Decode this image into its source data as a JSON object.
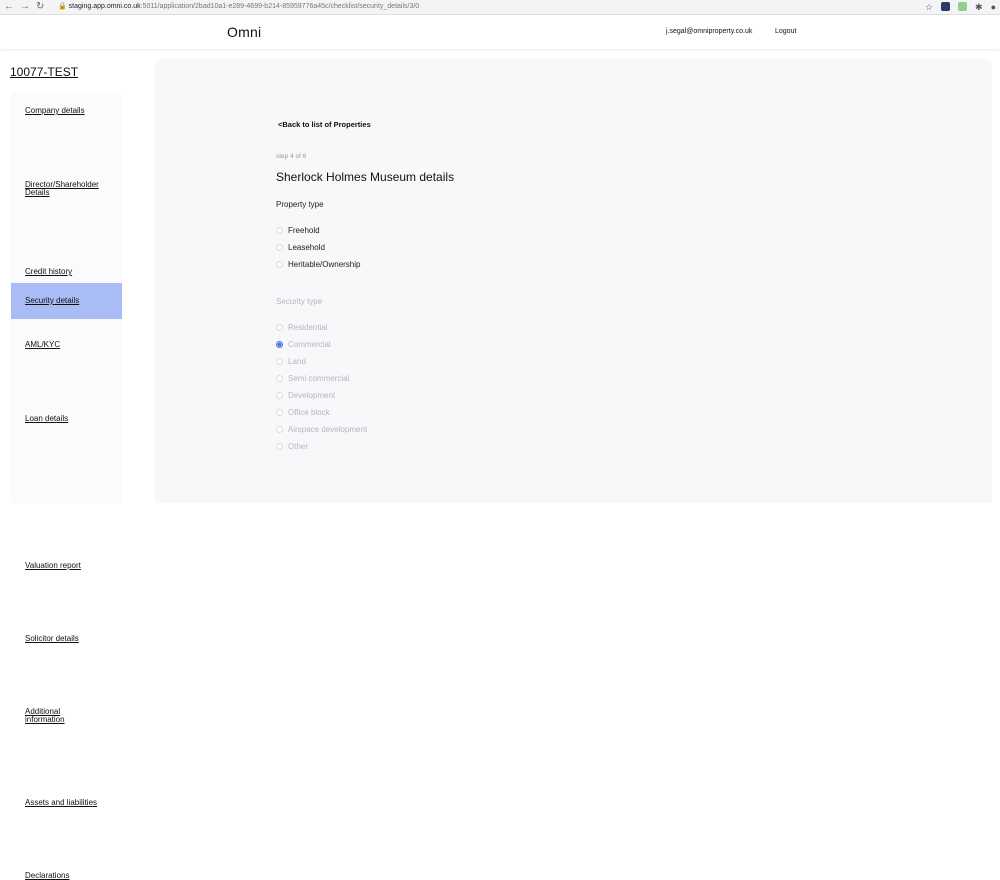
{
  "browser": {
    "back_icon": "arrow-left-icon",
    "forward_icon": "arrow-right-icon",
    "reload_icon": "reload-icon",
    "url_host": "staging.app.omni.co.uk",
    "url_path": ":5011/application/2bad10a1-e289-4699-b214-85959776a45c/checklist/security_details/3/0"
  },
  "header": {
    "brand": "Omni",
    "user_email": "j.segal@omniproperty.co.uk",
    "logout_label": "Logout"
  },
  "application": {
    "id": "10077-TEST"
  },
  "sidebar": {
    "items": [
      {
        "label": "Company details"
      },
      {
        "label": "Director/Shareholder Details",
        "line1": "Director/Shareholder",
        "line2": "Details"
      },
      {
        "label": "Credit history"
      },
      {
        "label": "AML/KYC"
      },
      {
        "label": "Loan details"
      },
      {
        "label": "Security details",
        "active": true
      },
      {
        "label": "Valuation report"
      },
      {
        "label": "Solicitor details"
      },
      {
        "label": "Additional information",
        "line1": "Additional",
        "line2": "information"
      },
      {
        "label": "Assets and liabilities"
      },
      {
        "label": "Declarations"
      }
    ]
  },
  "main": {
    "back_link": "<Back to list of Properties",
    "step": "step 4 of 6",
    "title": "Sherlock Holmes Museum details",
    "property_type": {
      "label": "Property type",
      "options": [
        "Freehold",
        "Leasehold",
        "Heritable/Ownership"
      ]
    },
    "security_type": {
      "label": "Security type",
      "selected": "Commercial",
      "options": [
        "Residential",
        "Commercial",
        "Land",
        "Semi commercial",
        "Development",
        "Office block",
        "Airspace development",
        "Other"
      ]
    }
  },
  "colors": {
    "active_nav": "#a9bcf5",
    "radio_selected": "#4a6ee0",
    "disabled_text": "#b5b5bd"
  }
}
